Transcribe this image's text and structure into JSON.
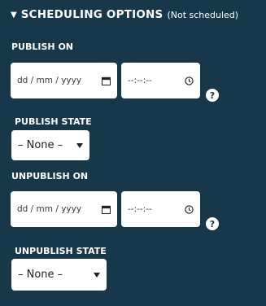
{
  "scheduling": {
    "summary_title": "SCHEDULING OPTIONS",
    "summary_status": "(Not scheduled)",
    "expanded_icon": "triangle-down-icon",
    "publish_on": {
      "label": "PUBLISH ON",
      "date_placeholder": "dd / mm / yyyy",
      "time_placeholder": "--:--:--",
      "help": "?"
    },
    "publish_state": {
      "label": "PUBLISH STATE",
      "selected": "– None –"
    },
    "unpublish_on": {
      "label": "UNPUBLISH ON",
      "date_placeholder": "dd / mm / yyyy",
      "time_placeholder": "--:--:--",
      "help": "?"
    },
    "unpublish_state": {
      "label": "UNPUBLISH STATE",
      "selected": "– None –"
    }
  },
  "colors": {
    "background": "#17374a",
    "text": "#ffffff",
    "field_bg": "#ffffff"
  }
}
